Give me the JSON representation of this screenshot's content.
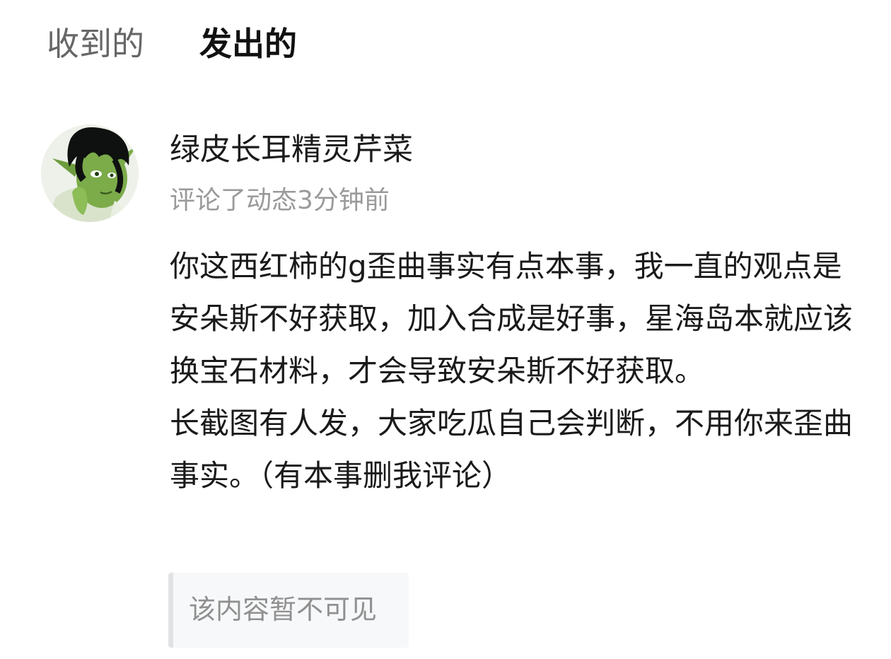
{
  "tabs": {
    "received": "收到的",
    "sent": "发出的",
    "active": "sent",
    "accent_color": "#16d3c4"
  },
  "comment": {
    "avatar_icon": "user-avatar-green-elf",
    "username": "绿皮长耳精灵芹菜",
    "meta": "评论了动态3分钟前",
    "text": "你这西红柿的g歪曲事实有点本事，我一直的观点是安朵斯不好获取，加入合成是好事，星海岛本就应该换宝石材料，才会导致安朵斯不好获取。\n长截图有人发，大家吃瓜自己会判断，不用你来歪曲事实。（有本事删我评论）",
    "quoted_content": "该内容暂不可见"
  }
}
